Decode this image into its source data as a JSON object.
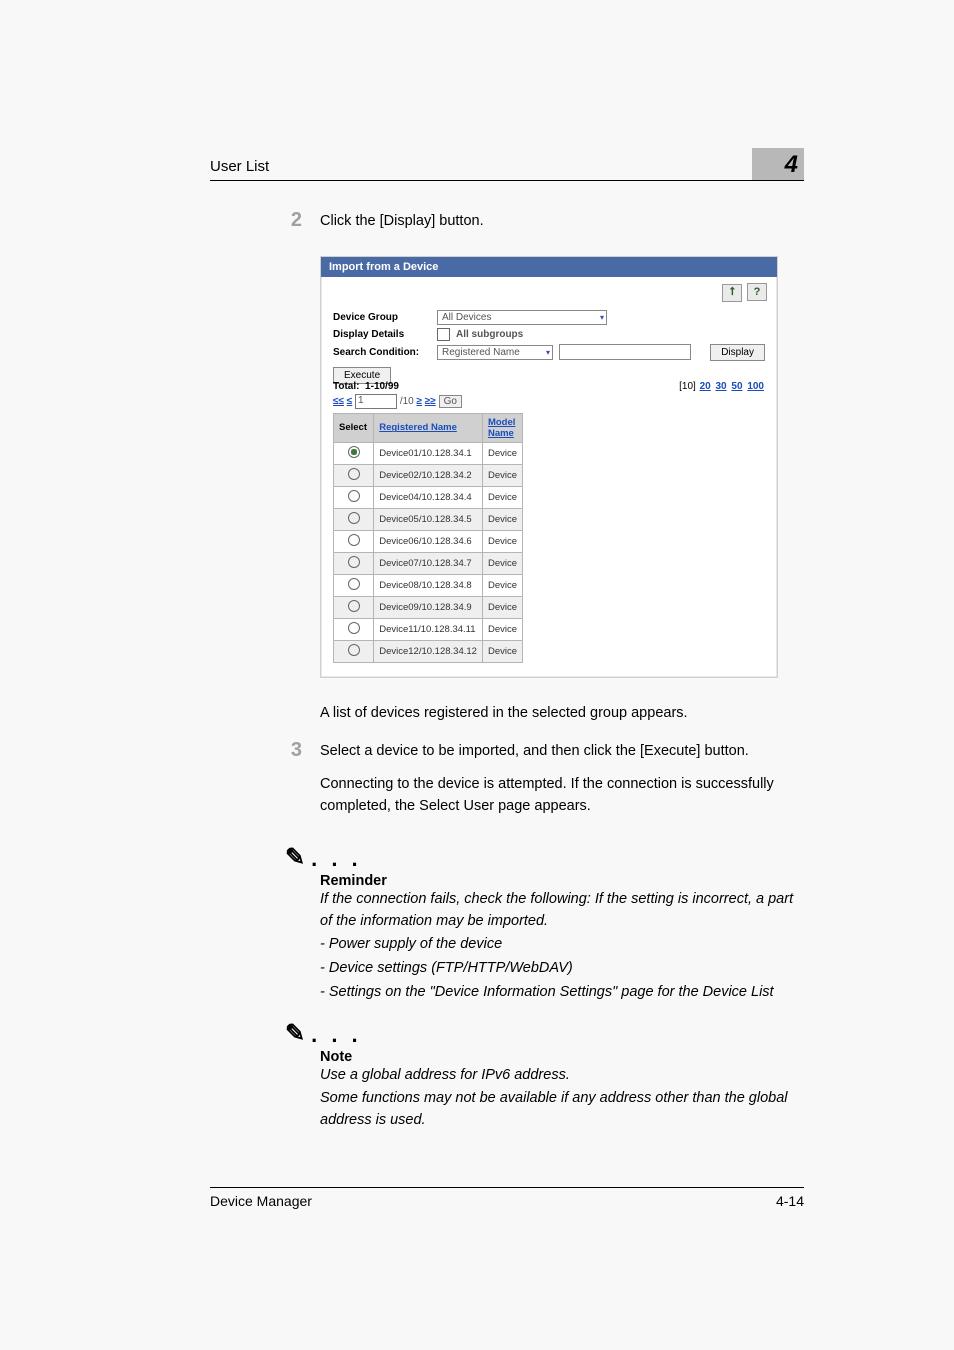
{
  "header": {
    "section_title": "User List",
    "chapter_number": "4"
  },
  "steps": {
    "s2": {
      "num": "2",
      "instruction": "Click the [Display] button."
    },
    "after_fig": "A list of devices registered in the selected group appears.",
    "s3": {
      "num": "3",
      "instruction": "Select a device to be imported, and then click the [Execute] button.",
      "detail": "Connecting to the device is attempted. If the connection is successfully completed, the Select User page appears."
    }
  },
  "figure": {
    "panel_title": "Import from a Device",
    "tool_back_glyph": "⭡",
    "tool_help_glyph": "?",
    "form": {
      "device_group_label": "Device Group",
      "device_group_value": "All Devices",
      "display_details_label": "Display Details",
      "display_details_checkbox_label": "All subgroups",
      "search_condition_label": "Search Condition:",
      "search_condition_value": "Registered Name",
      "display_button": "Display"
    },
    "execute_button": "Execute",
    "total_label": "Total:",
    "total_value": "1-10/99",
    "page_sizes": {
      "current": "[10]",
      "p20": "20",
      "p30": "30",
      "p50": "50",
      "p100": "100"
    },
    "pager": {
      "first": "≤≤",
      "prev": "≤",
      "page_value": "1",
      "of_text": "/10",
      "next": "≥",
      "last": "≥≥",
      "go": "Go"
    },
    "table": {
      "col_select": "Select",
      "col_regname": "Registered Name",
      "col_model": "Model Name",
      "rows": [
        {
          "sel": true,
          "name": "Device01/10.128.34.1",
          "model": "Device"
        },
        {
          "sel": false,
          "name": "Device02/10.128.34.2",
          "model": "Device"
        },
        {
          "sel": false,
          "name": "Device04/10.128.34.4",
          "model": "Device"
        },
        {
          "sel": false,
          "name": "Device05/10.128.34.5",
          "model": "Device"
        },
        {
          "sel": false,
          "name": "Device06/10.128.34.6",
          "model": "Device"
        },
        {
          "sel": false,
          "name": "Device07/10.128.34.7",
          "model": "Device"
        },
        {
          "sel": false,
          "name": "Device08/10.128.34.8",
          "model": "Device"
        },
        {
          "sel": false,
          "name": "Device09/10.128.34.9",
          "model": "Device"
        },
        {
          "sel": false,
          "name": "Device11/10.128.34.11",
          "model": "Device"
        },
        {
          "sel": false,
          "name": "Device12/10.128.34.12",
          "model": "Device"
        }
      ]
    }
  },
  "callouts": {
    "dots": ". . .",
    "reminder": {
      "title": "Reminder",
      "lines": [
        "If the connection fails, check the following: If the setting is incorrect, a part of the information may be imported.",
        "- Power supply of the device",
        "- Device settings (FTP/HTTP/WebDAV)",
        "- Settings on the \"Device Information Settings\" page for the Device List"
      ]
    },
    "note": {
      "title": "Note",
      "lines": [
        "Use a global address for IPv6 address.",
        "Some functions may not be available if any address other than the global address is used."
      ]
    }
  },
  "footer": {
    "left": "Device Manager",
    "right": "4-14"
  }
}
